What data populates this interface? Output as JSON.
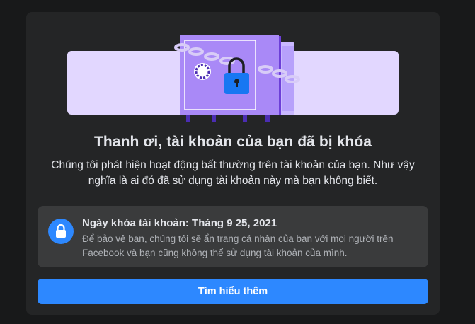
{
  "banner": {
    "illustration": "locked-safe-with-chain-illustration",
    "background_color": "#e2d7ff",
    "safe_color": "#a78bfa",
    "lock_color": "#1877f2"
  },
  "title": "Thanh ơi, tài khoản của bạn đã bị khóa",
  "description": "Chúng tôi phát hiện hoạt động bất thường trên tài khoản của bạn. Như vậy nghĩa là ai đó đã sử dụng tài khoản này mà bạn không biết.",
  "info": {
    "icon": "lock-icon",
    "title": "Ngày khóa tài khoản: Tháng 9 25, 2021",
    "text": "Để bảo vệ bạn, chúng tôi sẽ ẩn trang cá nhân của bạn với mọi người trên Facebook và bạn cũng không thể sử dụng tài khoản của mình."
  },
  "button": {
    "label": "Tìm hiểu thêm",
    "color": "#2d88ff"
  }
}
